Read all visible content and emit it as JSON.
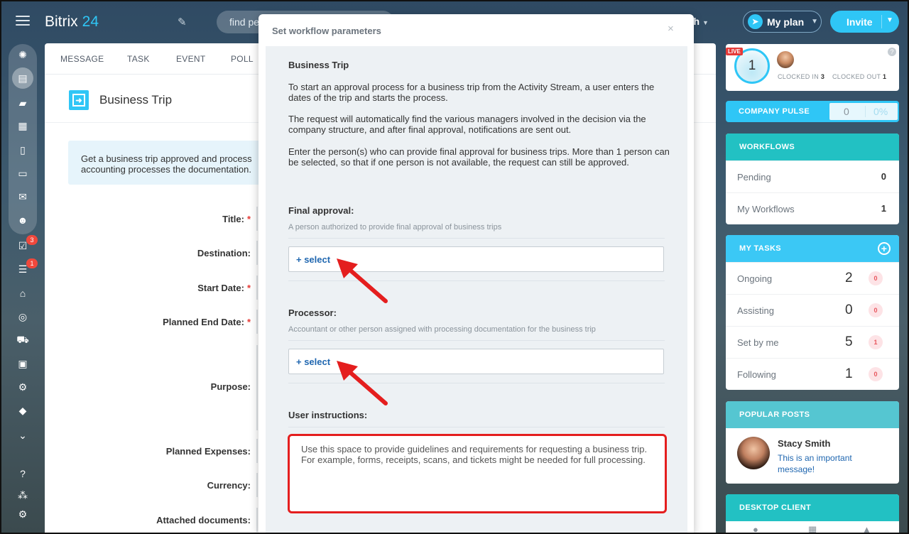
{
  "header": {
    "logo_word": "Bitrix",
    "logo_num": "24",
    "search_placeholder": "find pe",
    "username_tail": "ith",
    "myplan_label": "My plan",
    "invite_label": "Invite"
  },
  "left_rail": {
    "icons": [
      "pulse-icon",
      "feed-icon",
      "chat-icon",
      "calendar-icon",
      "docs-icon",
      "drive-icon",
      "mail-icon",
      "group-icon",
      "tasks-icon",
      "crm-filter-icon",
      "company-icon",
      "target-icon",
      "cart-icon",
      "contact-center-icon",
      "robot-icon",
      "box-icon",
      "more-icon",
      "help-icon",
      "sitemap-icon",
      "settings-icon"
    ],
    "badges": {
      "tasks": "3",
      "crm": "1"
    }
  },
  "page": {
    "tabs": [
      "MESSAGE",
      "TASK",
      "EVENT",
      "POLL"
    ],
    "title": "Business Trip",
    "info_line1": "Get a business trip approved and process",
    "info_line2": "accounting processes the documentation.",
    "fields": [
      {
        "label": "Title:",
        "required": true
      },
      {
        "label": "Destination:",
        "required": false
      },
      {
        "label": "Start Date:",
        "required": true
      },
      {
        "label": "Planned End Date:",
        "required": true
      },
      {
        "label": "Purpose:",
        "required": false
      },
      {
        "label": "Planned Expenses:",
        "required": false
      },
      {
        "label": "Currency:",
        "required": false
      },
      {
        "label": "Attached documents:",
        "required": false
      }
    ],
    "required_mark": "*"
  },
  "modal": {
    "title": "Set workflow parameters",
    "close": "×",
    "heading": "Business Trip",
    "para1": "To start an approval process for a business trip from the Activity Stream, a user enters the dates of the trip and starts the process.",
    "para2": "The request will automatically find the various managers involved in the decision via the company structure, and after final approval, notifications are sent out.",
    "para3": "Enter the person(s) who can provide final approval for business trips. More than 1 person can be selected, so that if one person is not available, the request can still be approved.",
    "final_approval": {
      "label": "Final approval:",
      "hint": "A person authorized to provide final approval of business trips",
      "select": "+ select"
    },
    "processor": {
      "label": "Processor:",
      "hint": "Accountant or other person assigned with processing documentation for the business trip",
      "select": "+ select"
    },
    "user_instructions": {
      "label": "User instructions:",
      "value": "Use this space to provide guidelines and requirements for requesting a business trip.\nFor example, forms, receipts, scans, and tickets might be needed for full processing."
    },
    "annotation_color": "#e41e1e"
  },
  "right": {
    "live_badge": "LIVE",
    "timer_value": "1",
    "clocked_in_label": "CLOCKED IN",
    "clocked_in_value": "3",
    "clocked_out_label": "CLOCKED OUT",
    "clocked_out_value": "1",
    "help": "?",
    "pulse": {
      "label": "COMPANY PULSE",
      "value": "0",
      "percent": "0%"
    },
    "workflows": {
      "title": "WORKFLOWS",
      "rows": [
        {
          "label": "Pending",
          "value": "0"
        },
        {
          "label": "My Workflows",
          "value": "1"
        }
      ]
    },
    "tasks": {
      "title": "MY TASKS",
      "add": "+",
      "rows": [
        {
          "label": "Ongoing",
          "count": "2",
          "overdue": "0"
        },
        {
          "label": "Assisting",
          "count": "0",
          "overdue": "0"
        },
        {
          "label": "Set by me",
          "count": "5",
          "overdue": "1"
        },
        {
          "label": "Following",
          "count": "1",
          "overdue": "0"
        }
      ]
    },
    "popular": {
      "title": "POPULAR POSTS",
      "author": "Stacy Smith",
      "text": "This is an important message!"
    },
    "desktop": {
      "title": "DESKTOP CLIENT",
      "icons": [
        "apple-icon",
        "windows-icon",
        "linux-icon"
      ]
    }
  },
  "colors": {
    "accent": "#2fc6f6",
    "workflows_header": "#22c1c3",
    "tasks_header": "#3bc8f5",
    "link": "#2067b0",
    "required": "#e53935",
    "badge": "#f0483c"
  }
}
